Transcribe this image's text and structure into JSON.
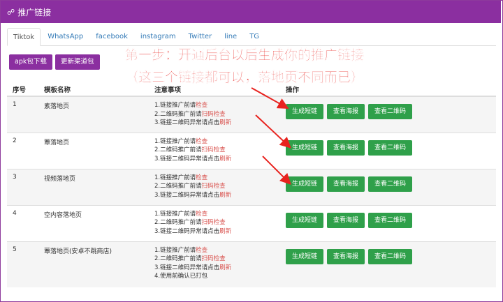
{
  "header": {
    "icon": "share-icon",
    "title": "推广链接"
  },
  "tabs": [
    {
      "label": "Tiktok",
      "active": true
    },
    {
      "label": "WhatsApp"
    },
    {
      "label": "facebook"
    },
    {
      "label": "instagram"
    },
    {
      "label": "Twitter"
    },
    {
      "label": "line"
    },
    {
      "label": "TG"
    }
  ],
  "toolbar": {
    "apk_button": "apk包下载",
    "update_button": "更新渠道包"
  },
  "overlay": {
    "line1": "第一步：开通后台以后生成你的推广链接",
    "line2": "（这三个链接都可以，落地页不同而已）"
  },
  "table": {
    "headers": [
      "序号",
      "模板名称",
      "注意事项",
      "操作"
    ],
    "note_parts": {
      "n1_prefix": "1.链接推广前请",
      "n1_link": "检查",
      "n2_prefix": "2.二维码推广前请",
      "n2_link": "扫码检查",
      "n3_prefix": "3.链接二维码异常请点击",
      "n3_link": "刷新",
      "n4": "4.使用前确认已打包"
    },
    "buttons": {
      "gen": "生成短链",
      "poster": "查看海报",
      "qr": "查看二维码"
    },
    "rows": [
      {
        "no": "1",
        "name": "素落地页"
      },
      {
        "no": "2",
        "name": "蕈落地页"
      },
      {
        "no": "3",
        "name": "视频落地页"
      },
      {
        "no": "4",
        "name": "空内容落地页"
      },
      {
        "no": "5",
        "name": "蕈落地页(安卓不跳商店)"
      }
    ]
  },
  "colors": {
    "brand": "#8b2fa0",
    "green": "#2fa04a",
    "annotation": "#e8231f"
  }
}
